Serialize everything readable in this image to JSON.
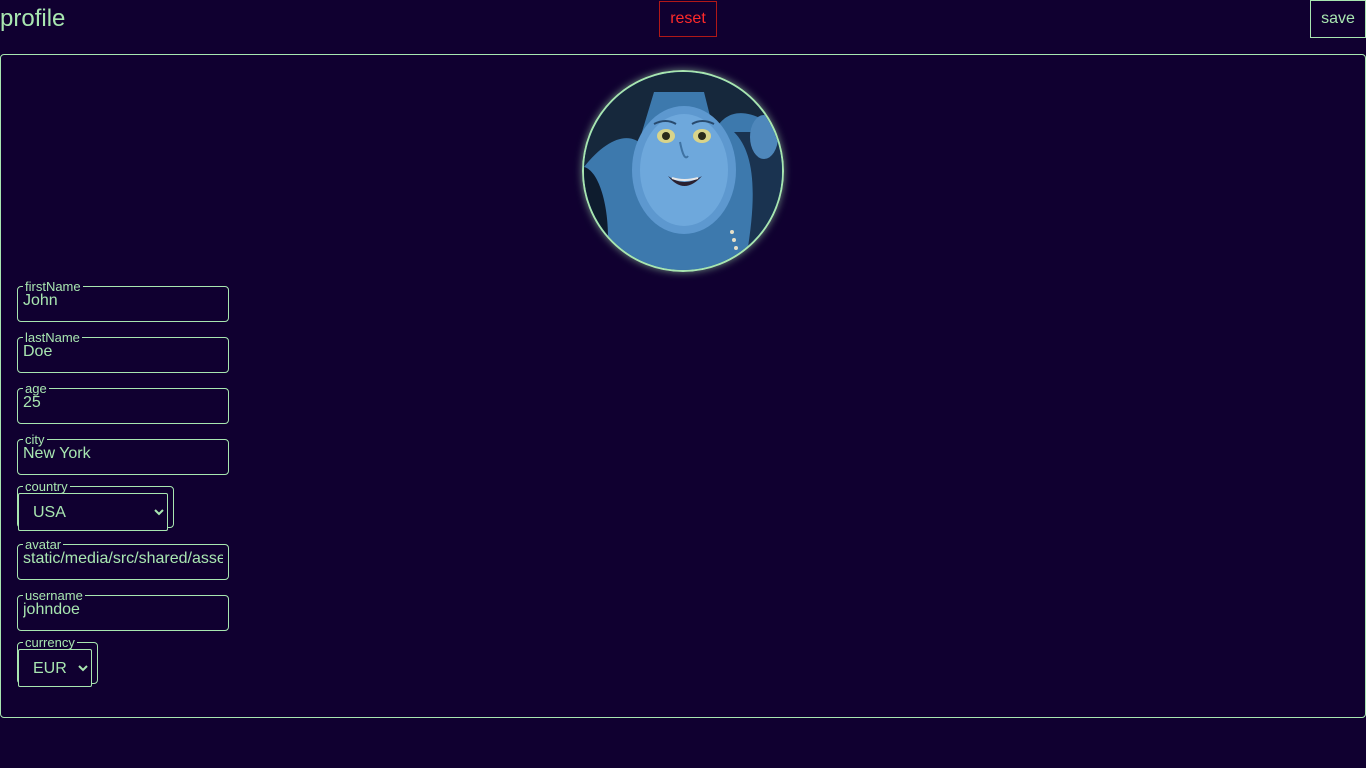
{
  "header": {
    "title": "profile",
    "reset_label": "reset",
    "save_label": "save"
  },
  "avatar": {
    "alt": "avatar"
  },
  "form": {
    "firstName": {
      "label": "firstName",
      "value": "John"
    },
    "lastName": {
      "label": "lastName",
      "value": "Doe"
    },
    "age": {
      "label": "age",
      "value": "25"
    },
    "city": {
      "label": "city",
      "value": "New York"
    },
    "country": {
      "label": "country",
      "value": "USA"
    },
    "avatar": {
      "label": "avatar",
      "value": "static/media/src/shared/assets"
    },
    "username": {
      "label": "username",
      "value": "johndoe"
    },
    "currency": {
      "label": "currency",
      "value": "EUR"
    }
  },
  "colors": {
    "background": "#100030",
    "accent": "#a8e6b0",
    "danger": "#ff2a2a"
  },
  "icons": {
    "country_dropdown": "chevron-down-icon",
    "currency_dropdown": "chevron-down-icon"
  }
}
